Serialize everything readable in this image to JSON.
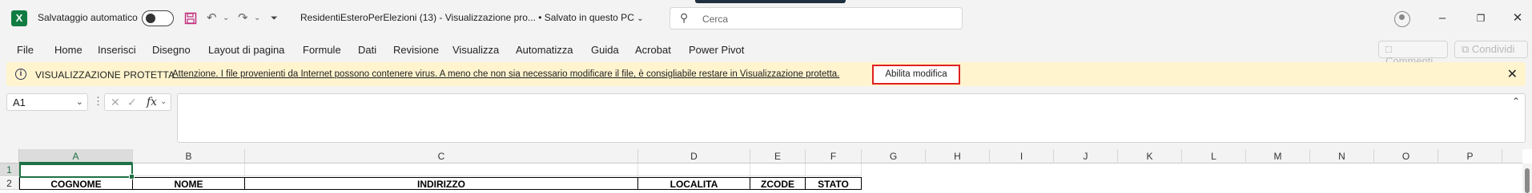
{
  "titlebar": {
    "app_logo": "X",
    "autosave_label": "Salvataggio automatico",
    "autosave_state": "off",
    "doc_title": "ResidentiEsteroPerElezioni (13)  -  Visualizzazione pro...  •  Salvato in questo PC",
    "search_placeholder": "Cerca",
    "icons": [
      "excel-icon",
      "save-icon",
      "undo-icon",
      "redo-icon",
      "customize-icon",
      "search-icon",
      "avatar-icon",
      "minimize-icon",
      "restore-icon",
      "close-icon"
    ]
  },
  "ribbon": {
    "tabs": [
      "File",
      "Home",
      "Inserisci",
      "Disegno",
      "Layout di pagina",
      "Formule",
      "Dati",
      "Revisione",
      "Visualizza",
      "Automatizza",
      "Guida",
      "Acrobat",
      "Power Pivot"
    ],
    "comments_label": "Commenti",
    "share_label": "Condividi"
  },
  "protected_view": {
    "title": "VISUALIZZAZIONE PROTETTA",
    "message": "Attenzione. I file provenienti da Internet possono contenere virus. A meno che non sia necessario modificare il file, è consigliabile restare in Visualizzazione protetta.",
    "enable_button": "Abilita modifica"
  },
  "formula_bar": {
    "name_box": "A1",
    "fx_label": "fx",
    "value": ""
  },
  "grid": {
    "columns": [
      "A",
      "B",
      "C",
      "D",
      "E",
      "F",
      "G",
      "H",
      "I",
      "J",
      "K",
      "L",
      "M",
      "N",
      "O",
      "P"
    ],
    "selected_column": "A",
    "rows": [
      "1",
      "2"
    ],
    "row2": [
      "COGNOME",
      "NOME",
      "INDIRIZZO",
      "LOCALITA",
      "ZCODE",
      "STATO"
    ]
  },
  "colors": {
    "excel_green": "#107c41",
    "selection_green": "#1e7145",
    "protected_bar": "#fff4ce",
    "highlight_red": "#e02020"
  }
}
